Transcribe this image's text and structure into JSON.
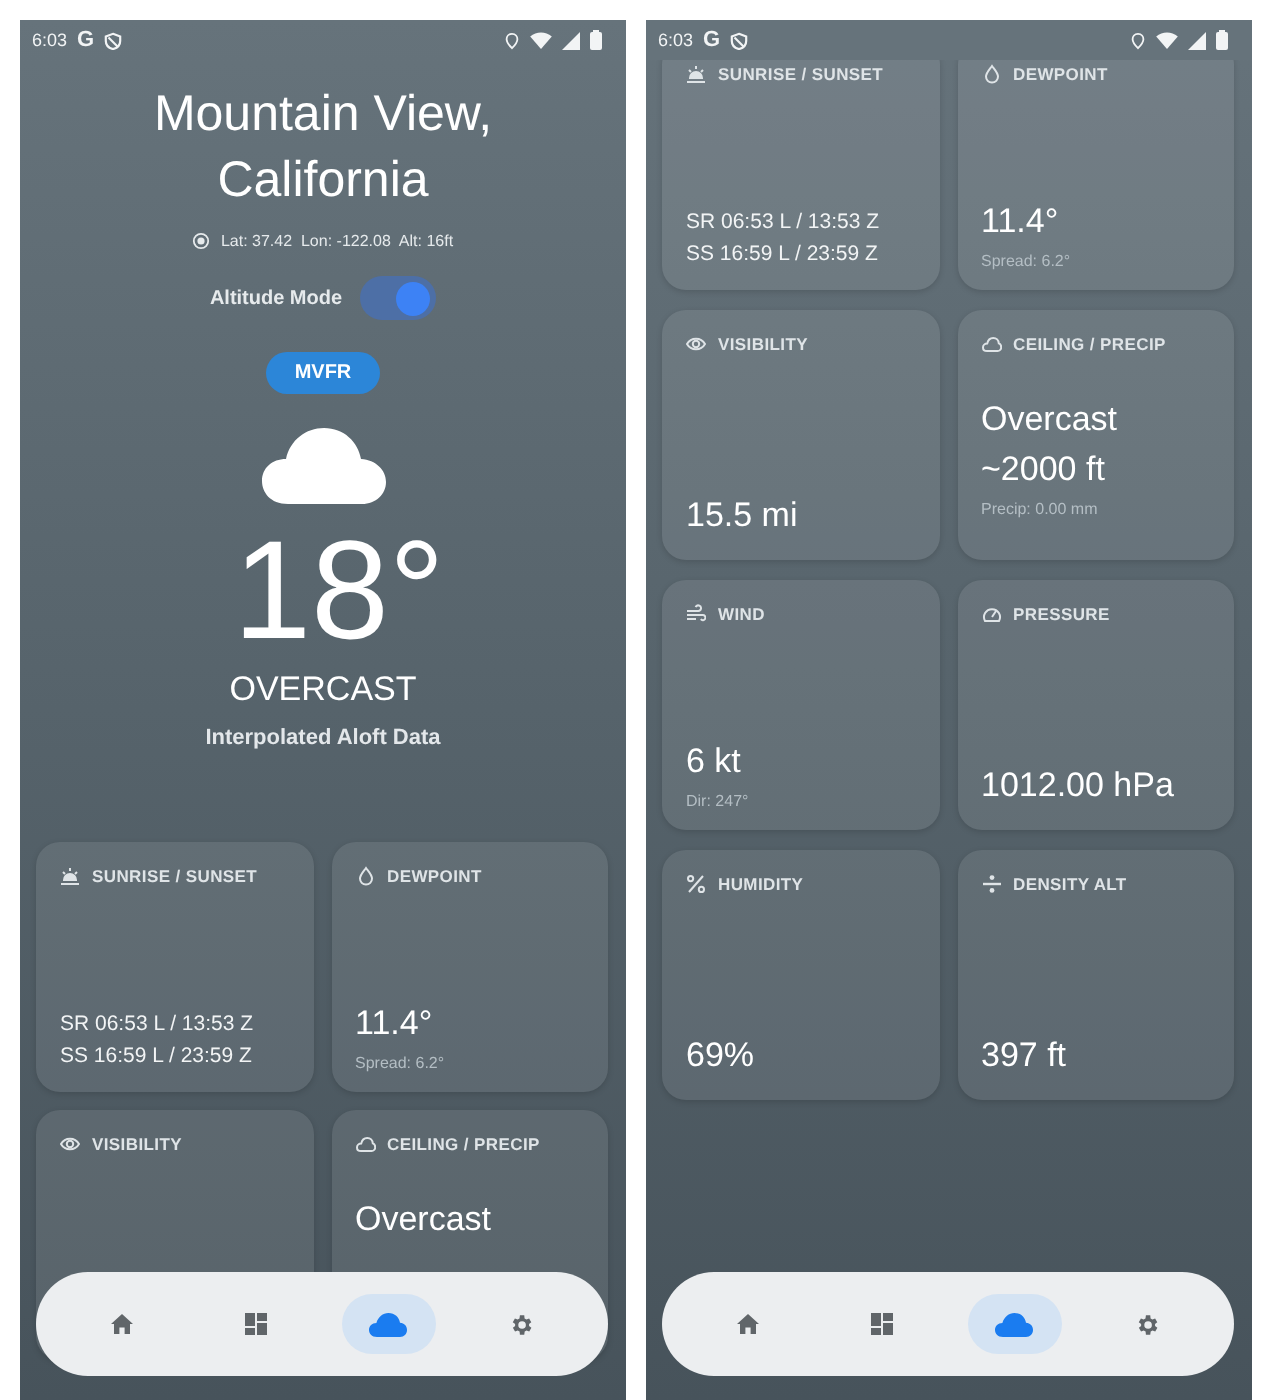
{
  "screens": [
    {
      "status_bar": {
        "time": "6:03",
        "carrier": "G"
      },
      "header": {
        "city": "Mountain View, California",
        "coords": "Lat: 37.42  Lon: -122.08  Alt: 16ft",
        "toggle": {
          "label": "Altitude Mode",
          "on": true
        },
        "badge": "MVFR",
        "temperature": "18°",
        "condition": "OVERCAST",
        "source": "Interpolated Aloft Data"
      },
      "cards": [
        {
          "label": "SUNRISE / SUNSET",
          "times": [
            "SR 06:53 L / 13:53 Z",
            "SS 16:59 L / 23:59 Z"
          ]
        },
        {
          "label": "DEWPOINT",
          "values": [
            "11.4°"
          ],
          "note": "Spread: 6.2°"
        },
        {
          "label": "VISIBILITY"
        },
        {
          "label": "CEILING / PRECIP",
          "values": [
            "Overcast"
          ]
        }
      ],
      "nav": [
        {
          "selected": false
        },
        {
          "selected": false
        },
        {
          "selected": true
        },
        {
          "selected": false
        }
      ]
    },
    {
      "status_bar": {
        "time": "6:03",
        "carrier": "G"
      },
      "cards": [
        {
          "label": "SUNRISE / SUNSET",
          "times": [
            "SR 06:53 L / 13:53 Z",
            "SS 16:59 L / 23:59 Z"
          ]
        },
        {
          "label": "DEWPOINT",
          "values": [
            "11.4°"
          ],
          "note": "Spread: 6.2°"
        },
        {
          "label": "VISIBILITY",
          "values": [
            "15.5 mi"
          ]
        },
        {
          "label": "CEILING / PRECIP",
          "values": [
            "Overcast",
            "~2000 ft"
          ],
          "note": "Precip: 0.00 mm"
        },
        {
          "label": "WIND",
          "values": [
            "6 kt"
          ],
          "note": "Dir: 247°"
        },
        {
          "label": "PRESSURE",
          "values": [
            "1012.00 hPa"
          ]
        },
        {
          "label": "HUMIDITY",
          "values": [
            "69%"
          ]
        },
        {
          "label": "DENSITY ALT",
          "values": [
            "397 ft"
          ]
        }
      ],
      "nav": [
        {
          "selected": false
        },
        {
          "selected": false
        },
        {
          "selected": true
        },
        {
          "selected": false
        }
      ]
    }
  ]
}
